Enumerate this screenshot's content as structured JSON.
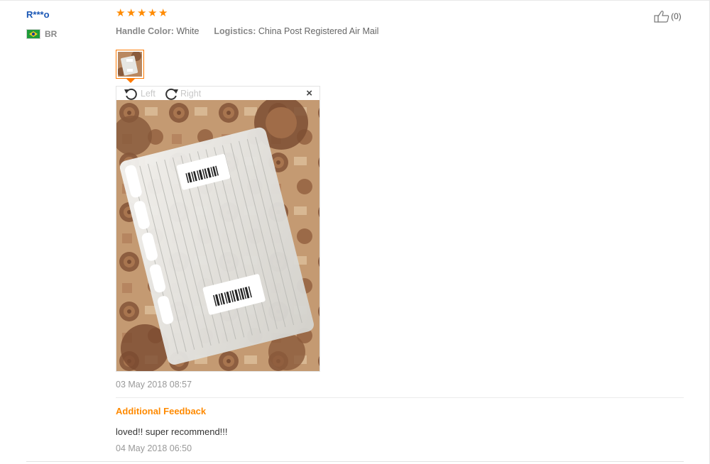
{
  "review": {
    "user": "R***o",
    "country": "BR",
    "rating": 5,
    "star_glyph": "★",
    "attributes": [
      {
        "key": "Handle Color:",
        "value": "White"
      },
      {
        "key": "Logistics:",
        "value": "China Post Registered Air Mail"
      }
    ],
    "helpful_count": "(0)",
    "date": "03 May 2018 08:57"
  },
  "image_viewer": {
    "rotate_left_label": "Left",
    "rotate_right_label": "Right",
    "close_glyph": "×"
  },
  "additional_feedback": {
    "title": "Additional Feedback",
    "text": "loved!! super recommend!!!",
    "date": "04 May 2018 06:50"
  },
  "colors": {
    "username": "#1a57b5",
    "accent_orange": "#ff8a00",
    "muted": "#999999"
  },
  "icons": {
    "thumbs_up": "thumbs-up-icon",
    "rotate_left": "rotate-left-icon",
    "rotate_right": "rotate-right-icon",
    "close": "close-icon",
    "flag": "brazil-flag-icon"
  }
}
